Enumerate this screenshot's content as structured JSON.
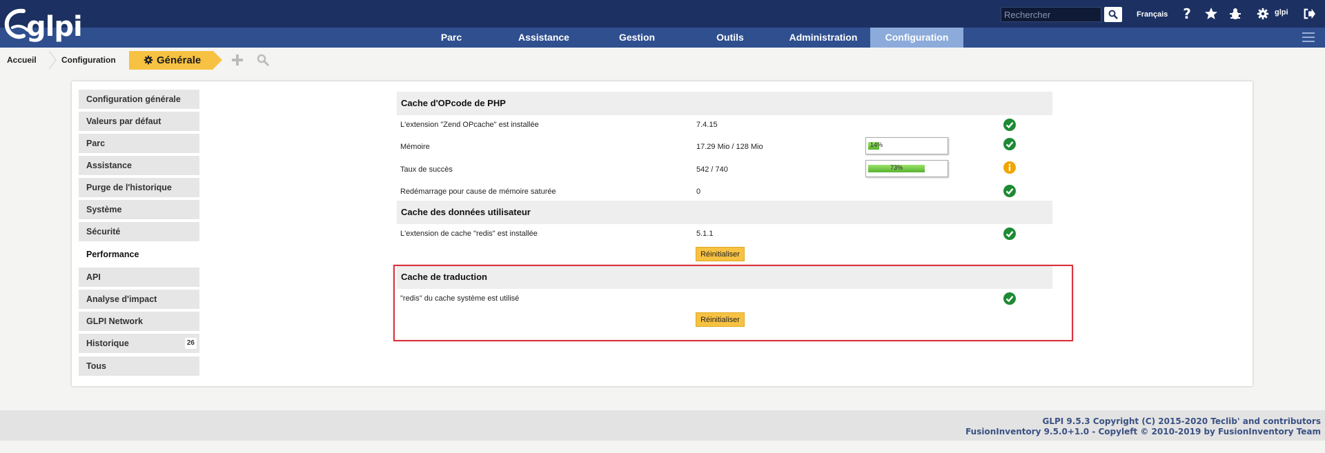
{
  "header": {
    "logo_text": "glpi",
    "search_placeholder": "Rechercher",
    "language": "Français",
    "user": "glpi"
  },
  "nav": [
    "Parc",
    "Assistance",
    "Gestion",
    "Outils",
    "Administration",
    "Configuration"
  ],
  "breadcrumb": {
    "home": "Accueil",
    "section": "Configuration",
    "current": "Générale"
  },
  "sidebar": {
    "items": [
      {
        "label": "Configuration générale"
      },
      {
        "label": "Valeurs par défaut"
      },
      {
        "label": "Parc"
      },
      {
        "label": "Assistance"
      },
      {
        "label": "Purge de l'historique"
      },
      {
        "label": "Système"
      },
      {
        "label": "Sécurité"
      },
      {
        "label": "Performance"
      },
      {
        "label": "API"
      },
      {
        "label": "Analyse d'impact"
      },
      {
        "label": "GLPI Network"
      },
      {
        "label": "Historique",
        "badge": "26"
      },
      {
        "label": "Tous"
      }
    ]
  },
  "sections": {
    "opcache": {
      "title": "Cache d'OPcode de PHP",
      "rows": [
        {
          "label": "L'extension \"Zend OPcache\" est installée",
          "value": "7.4.15"
        },
        {
          "label": "Mémoire",
          "value": "17.29 Mio / 128 Mio",
          "progress_label": "14%",
          "progress": 0.14
        },
        {
          "label": "Taux de succès",
          "value": "542 / 740",
          "progress_label": "73%",
          "progress": 0.73
        },
        {
          "label": "Redémarrage pour cause de mémoire saturée",
          "value": "0"
        }
      ]
    },
    "user_cache": {
      "title": "Cache des données utilisateur",
      "rows": [
        {
          "label": "L'extension de cache \"redis\" est installée",
          "value": "5.1.1"
        }
      ],
      "button": "Réinitialiser"
    },
    "translation": {
      "title": "Cache de traduction",
      "rows": [
        {
          "label": "\"redis\" du cache système est utilisé"
        }
      ],
      "button": "Réinitialiser"
    }
  },
  "footer": {
    "line1": "GLPI 9.5.3 Copyright (C) 2015-2020 Teclib' and contributors",
    "line2": "FusionInventory 9.5.0+1.0 - Copyleft © 2010-2019 by FusionInventory Team"
  },
  "colors": {
    "topbar": "#1c3162",
    "navbar": "#2f4f8f",
    "nav_active": "#8cabdb",
    "accent": "#f7c242",
    "ok": "#1e8a34",
    "warning": "#f1a500",
    "highlight": "#d9343d"
  }
}
